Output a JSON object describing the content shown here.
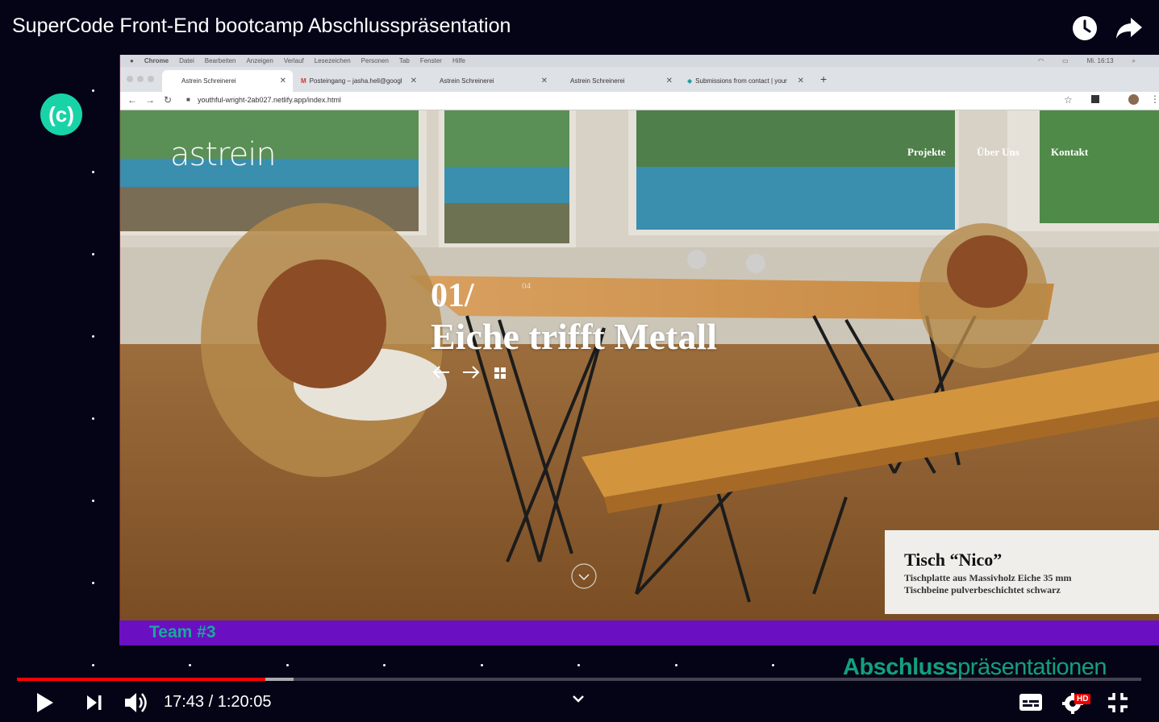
{
  "video": {
    "title": "SuperCode Front-End bootcamp Abschlusspräsentation",
    "logo_text": "(c)",
    "team_label": "Team #3",
    "banner_part1": "Abschluss",
    "banner_part2": "präsentationen"
  },
  "mac": {
    "menu": [
      "Chrome",
      "Datei",
      "Bearbeiten",
      "Anzeigen",
      "Verlauf",
      "Lesezeichen",
      "Personen",
      "Tab",
      "Fenster",
      "Hilfe"
    ],
    "clock": "Mi. 16:13"
  },
  "browser": {
    "tabs": [
      {
        "label": "Astrein Schreinerei"
      },
      {
        "label": "Posteingang – jasha.hell@googl"
      },
      {
        "label": "Astrein Schreinerei"
      },
      {
        "label": "Astrein Schreinerei"
      },
      {
        "label": "Submissions from contact | your"
      }
    ],
    "url": "youthful-wright-2ab027.netlify.app/index.html"
  },
  "site": {
    "logo": "astrein",
    "nav": [
      "Projekte",
      "Über Uns",
      "Kontakt"
    ],
    "slide_number": "01/",
    "slide_total": "04",
    "slide_title": "Eiche trifft Metall",
    "product": {
      "title": "Tisch “Nico”",
      "line1": "Tischplatte aus Massivholz Eiche 35 mm",
      "line2": "Tischbeine pulverbeschichtet schwarz"
    }
  },
  "player": {
    "time": "17:43 / 1:20:05",
    "progress": 0.2213,
    "buffered": 0.246,
    "hd_badge": "HD",
    "colors": {
      "played": "#ff0000",
      "accent": "#19d3a8",
      "team_bar": "#6a0fc2"
    }
  },
  "icons": [
    "watch-later-icon",
    "share-icon",
    "play-icon",
    "next-icon",
    "volume-icon",
    "chevron-down-icon",
    "captions-icon",
    "settings-icon",
    "exit-fullscreen-icon"
  ]
}
